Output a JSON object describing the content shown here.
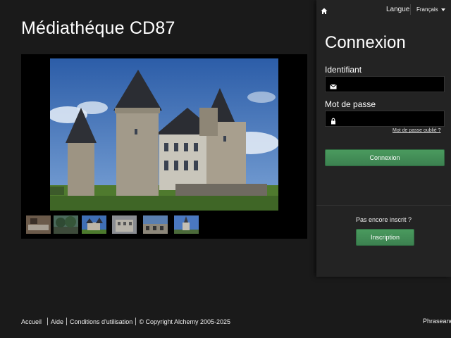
{
  "site": {
    "title": "Médiathéque CD87"
  },
  "gallery": {
    "thumbnails": [
      {
        "name": "thumbnail-interior"
      },
      {
        "name": "thumbnail-trees"
      },
      {
        "name": "thumbnail-chateau"
      },
      {
        "name": "thumbnail-building"
      },
      {
        "name": "thumbnail-facade"
      },
      {
        "name": "thumbnail-church"
      }
    ]
  },
  "login": {
    "topbar": {
      "language_label": "Langue",
      "language_value": "Français"
    },
    "title": "Connexion",
    "username_label": "Identifiant",
    "username_value": "",
    "password_label": "Mot de passe",
    "password_value": "",
    "forgot_password": "Mot de passe oublié ?",
    "submit_label": "Connexion",
    "not_registered": "Pas encore inscrit ?",
    "register_label": "Inscription"
  },
  "footer": {
    "links": [
      "Accueil",
      "Aide",
      "Conditions d'utilisation"
    ],
    "copyright": "© Copyright Alchemy 2005-2025",
    "brand": "Phraseanet"
  },
  "colors": {
    "background": "#1a1a1a",
    "panel": "#232323",
    "button_green": "#3c8150",
    "sky": "#3d6fb3"
  },
  "icons": {
    "home": "home-icon",
    "envelope": "envelope-icon",
    "lock": "lock-icon",
    "caret": "caret-down-icon"
  }
}
